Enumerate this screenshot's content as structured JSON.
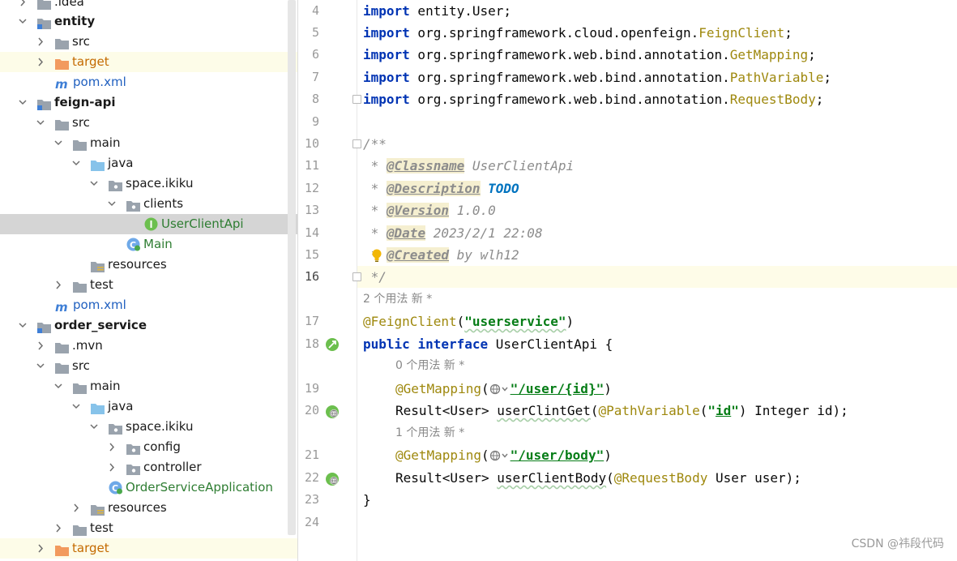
{
  "project_tree": {
    "rows": [
      {
        "label": ".idea",
        "kind": "folder",
        "chevron": "closed",
        "style": ""
      },
      {
        "label": "entity",
        "kind": "module",
        "chevron": "open",
        "style": "bold"
      },
      {
        "label": "src",
        "kind": "folder",
        "chevron": "closed",
        "style": ""
      },
      {
        "label": "target",
        "kind": "folder-orange",
        "chevron": "closed",
        "style": "orange"
      },
      {
        "label": "pom.xml",
        "kind": "maven",
        "chevron": "none",
        "style": "blue"
      },
      {
        "label": "feign-api",
        "kind": "module",
        "chevron": "open",
        "style": "bold"
      },
      {
        "label": "src",
        "kind": "folder",
        "chevron": "open",
        "style": ""
      },
      {
        "label": "main",
        "kind": "folder",
        "chevron": "open",
        "style": ""
      },
      {
        "label": "java",
        "kind": "folder-blue",
        "chevron": "open",
        "style": ""
      },
      {
        "label": "space.ikiku",
        "kind": "package",
        "chevron": "open",
        "style": ""
      },
      {
        "label": "clients",
        "kind": "package",
        "chevron": "open",
        "style": ""
      },
      {
        "label": "UserClientApi",
        "kind": "interface",
        "chevron": "none",
        "style": "green"
      },
      {
        "label": "Main",
        "kind": "class",
        "chevron": "none",
        "style": "green"
      },
      {
        "label": "resources",
        "kind": "resources",
        "chevron": "none",
        "style": ""
      },
      {
        "label": "test",
        "kind": "folder",
        "chevron": "closed",
        "style": ""
      },
      {
        "label": "pom.xml",
        "kind": "maven",
        "chevron": "none",
        "style": "blue"
      },
      {
        "label": "order_service",
        "kind": "module",
        "chevron": "open",
        "style": "bold"
      },
      {
        "label": ".mvn",
        "kind": "folder",
        "chevron": "closed",
        "style": ""
      },
      {
        "label": "src",
        "kind": "folder",
        "chevron": "open",
        "style": ""
      },
      {
        "label": "main",
        "kind": "folder",
        "chevron": "open",
        "style": ""
      },
      {
        "label": "java",
        "kind": "folder-blue",
        "chevron": "open",
        "style": ""
      },
      {
        "label": "space.ikiku",
        "kind": "package",
        "chevron": "open",
        "style": ""
      },
      {
        "label": "config",
        "kind": "package",
        "chevron": "closed",
        "style": ""
      },
      {
        "label": "controller",
        "kind": "package",
        "chevron": "closed",
        "style": ""
      },
      {
        "label": "OrderServiceApplication",
        "kind": "class",
        "chevron": "none",
        "style": "green"
      },
      {
        "label": "resources",
        "kind": "resources",
        "chevron": "closed",
        "style": ""
      },
      {
        "label": "test",
        "kind": "folder",
        "chevron": "closed",
        "style": ""
      },
      {
        "label": "target",
        "kind": "folder-orange",
        "chevron": "closed",
        "style": "orange"
      }
    ]
  },
  "editor": {
    "line_numbers": [
      "4",
      "5",
      "6",
      "7",
      "8",
      "9",
      "10",
      "11",
      "12",
      "13",
      "14",
      "15",
      "16",
      "17",
      "18",
      "19",
      "20",
      "21",
      "22",
      "23",
      "24"
    ],
    "current_line": "16",
    "usage_hints": {
      "interface": "2 个用法   新 *",
      "get": "0 个用法   新 *",
      "body": "1 个用法   新 *"
    },
    "code": {
      "l4_kw": "import",
      "l4_rest": " entity.User;",
      "l5_kw": "import",
      "l5_pkg": " org.springframework.cloud.openfeign.",
      "l5_cls": "FeignClient",
      "l5_end": ";",
      "l6_kw": "import",
      "l6_pkg": " org.springframework.web.bind.annotation.",
      "l6_cls": "GetMapping",
      "l6_end": ";",
      "l7_kw": "import",
      "l7_pkg": " org.springframework.web.bind.annotation.",
      "l7_cls": "PathVariable",
      "l7_end": ";",
      "l8_kw": "import",
      "l8_pkg": " org.springframework.web.bind.annotation.",
      "l8_cls": "RequestBody",
      "l8_end": ";",
      "l10": "/**",
      "l11_pre": " * ",
      "l11_tag": "@Classname",
      "l11_val": " UserClientApi",
      "l12_pre": " * ",
      "l12_tag": "@Description",
      "l12_sp": " ",
      "l12_val": "TODO",
      "l13_pre": " * ",
      "l13_tag": "@Version",
      "l13_val": " 1.0.0",
      "l14_pre": " * ",
      "l14_tag": "@Date",
      "l14_val": " 2023/2/1 22:08",
      "l15_pre": " * ",
      "l15_tag": "@Created",
      "l15_val": " by wlh12",
      "l16": " */",
      "l17_ann": "@FeignClient",
      "l17_open": "(",
      "l17_str": "\"userservice\"",
      "l17_close": ")",
      "l18_kw1": "public",
      "l18_kw2": "interface",
      "l18_name": "UserClientApi",
      "l18_end": " {",
      "l19_ann": "@GetMapping",
      "l19_open": "(",
      "l19_str": "\"/user/{id}\"",
      "l19_close": ")",
      "l20_type": "Result<User> ",
      "l20_m": "userClintGet",
      "l20_open": "(",
      "l20_ann": "@PathVariable",
      "l20_p1": "(",
      "l20_q1": "\"",
      "l20_id": "id",
      "l20_q2": "\"",
      "l20_rest": ") Integer id);",
      "l21_ann": "@GetMapping",
      "l21_open": "(",
      "l21_str": "\"/user/body\"",
      "l21_close": ")",
      "l22_type": "Result<User> ",
      "l22_m": "userClientBody",
      "l22_open": "(",
      "l22_ann": "@RequestBody",
      "l22_rest": " User user);",
      "l23": "}"
    },
    "icon_names": [
      "bulb-icon",
      "feign-interface-icon",
      "web-endpoint-icon"
    ]
  },
  "watermark": "CSDN @祎段代码",
  "colors": {
    "keyword": "#0033b3",
    "annotation": "#9e880d",
    "string": "#067d17",
    "doc_comment": "#8c8c8c",
    "todo": "#0073bf",
    "selection": "#d5d5d5",
    "excluded_row": "#fdfce8"
  }
}
